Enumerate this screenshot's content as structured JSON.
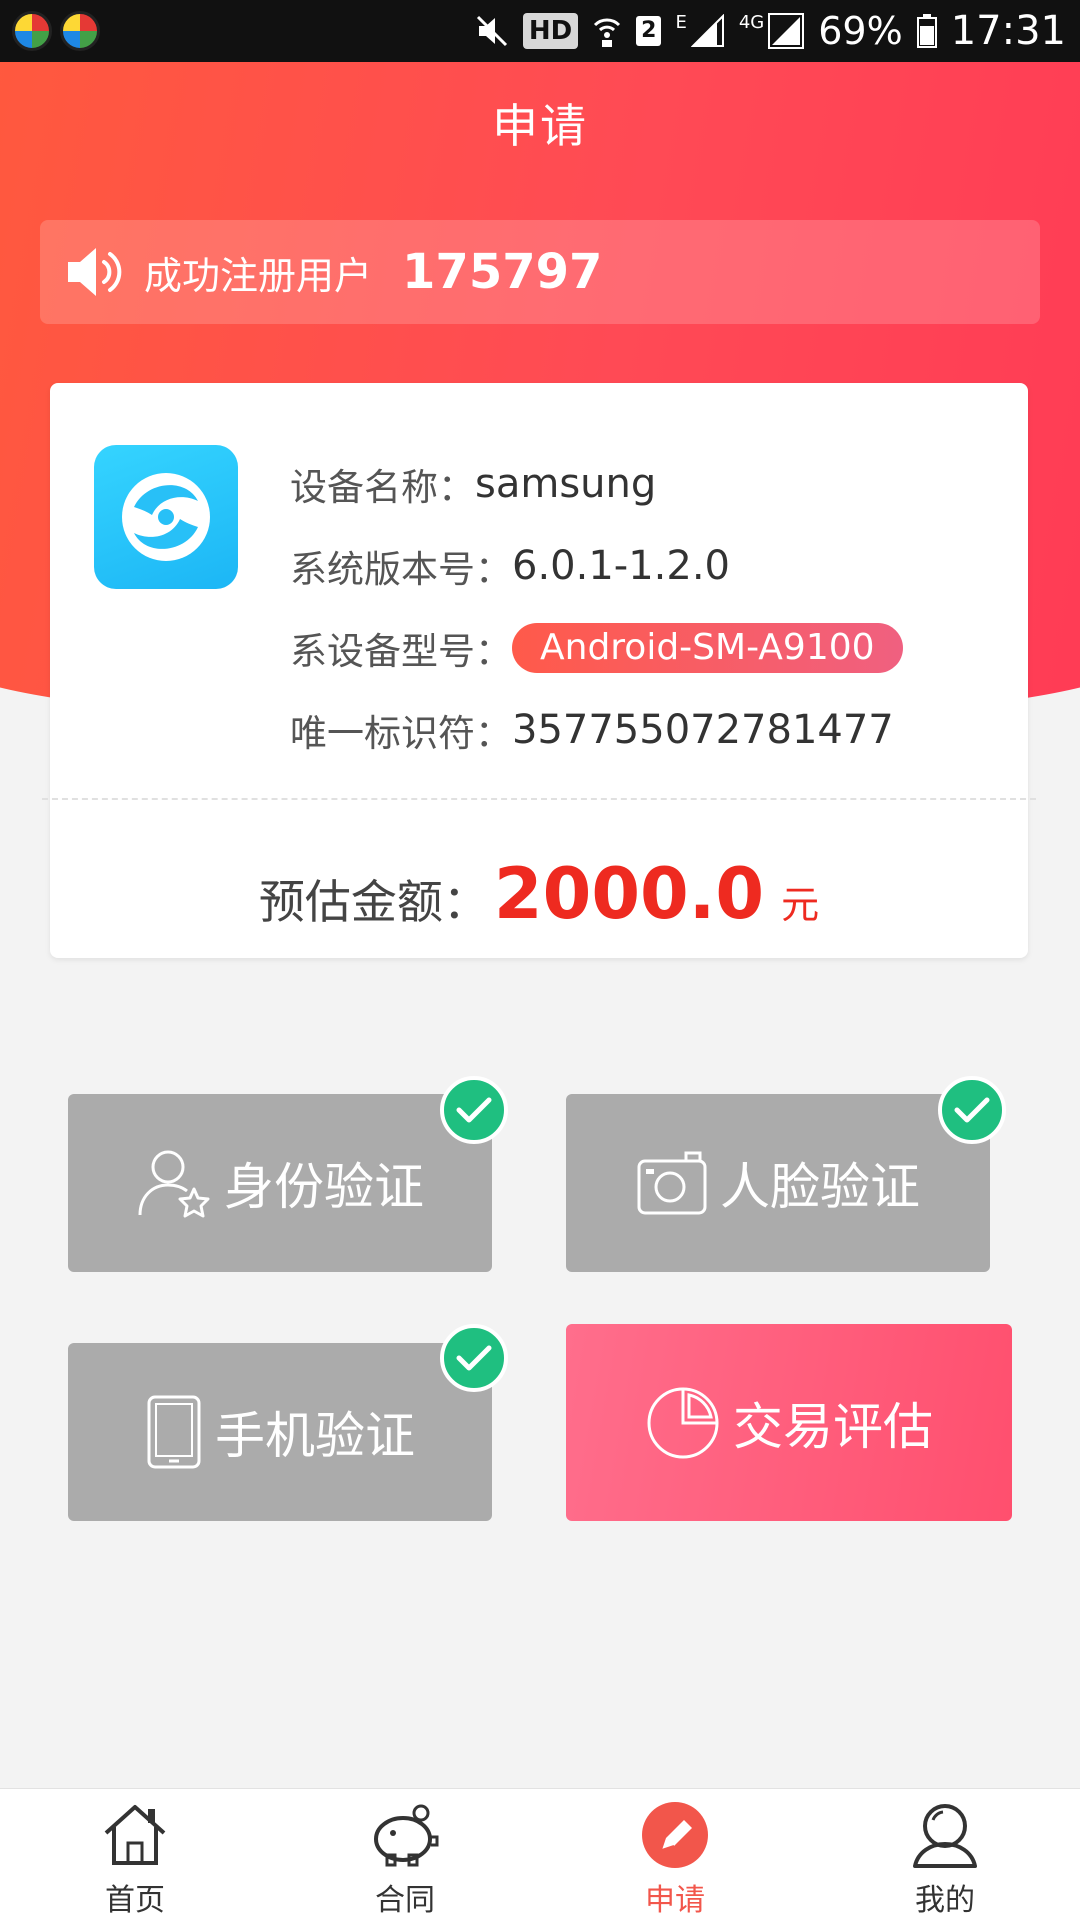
{
  "status_bar": {
    "hd": "HD",
    "sim": "2",
    "network_e": "E",
    "network_4g": "4G",
    "battery": "69%",
    "time": "17:31"
  },
  "header": {
    "title": "申请"
  },
  "notice": {
    "text": "成功注册用户",
    "count": "175797",
    "icon": "speaker-icon"
  },
  "device": {
    "name_label": "设备名称：",
    "name_value": "samsung",
    "version_label": "系统版本号：",
    "version_value": "6.0.1-1.2.0",
    "model_label": "系设备型号：",
    "model_value": "Android-SM-A9100",
    "id_label": "唯一标识符：",
    "id_value": "357755072781477"
  },
  "estimate": {
    "label": "预估金额：",
    "value": "2000.0",
    "unit": "元"
  },
  "tiles": [
    {
      "label": "身份验证",
      "icon": "user-star-icon",
      "verified": true
    },
    {
      "label": "人脸验证",
      "icon": "camera-icon",
      "verified": true
    },
    {
      "label": "手机验证",
      "icon": "phone-icon",
      "verified": true
    },
    {
      "label": "交易评估",
      "icon": "pie-chart-icon",
      "verified": false
    }
  ],
  "nav": {
    "items": [
      {
        "label": "首页",
        "icon": "home-icon"
      },
      {
        "label": "合同",
        "icon": "piggy-bank-icon"
      },
      {
        "label": "申请",
        "icon": "pencil-icon"
      },
      {
        "label": "我的",
        "icon": "person-icon"
      }
    ],
    "selected_index": 2
  },
  "colors": {
    "header_start": "#ff5a3c",
    "header_end": "#ff3a55",
    "amount": "#ee2a20",
    "check": "#1fbf80",
    "active_tile": "#ff5a78",
    "tile_gray": "#ababab",
    "nav_selected": "#f2564b"
  }
}
